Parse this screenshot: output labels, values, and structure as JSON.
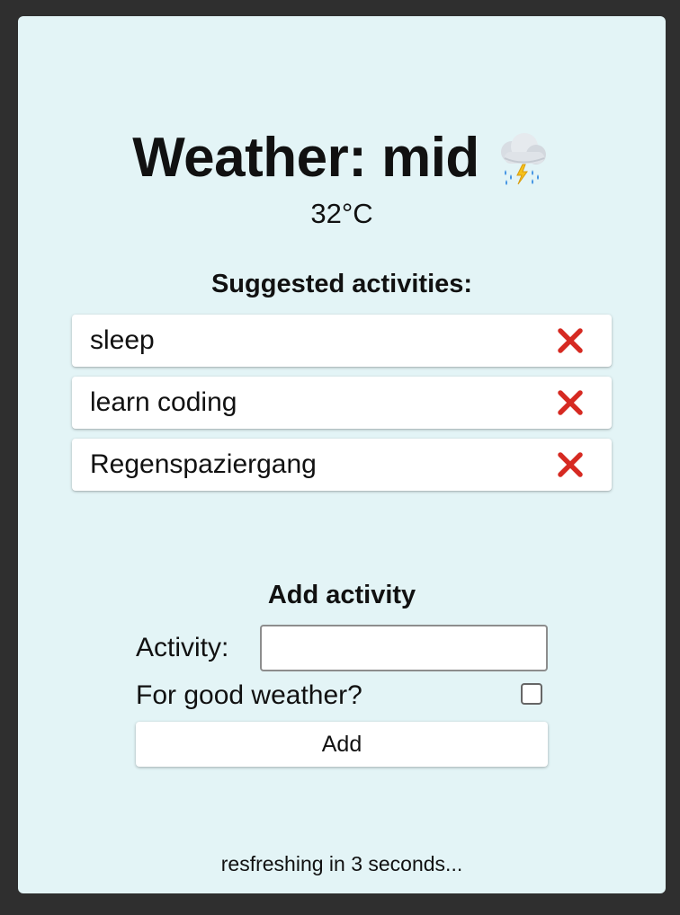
{
  "header": {
    "title": "Weather: mid",
    "weather_icon": "thunder-cloud-rain-icon",
    "temperature": "32°C"
  },
  "suggestions": {
    "title": "Suggested activities:",
    "items": [
      {
        "label": "sleep"
      },
      {
        "label": "learn coding"
      },
      {
        "label": "Regenspaziergang"
      }
    ],
    "delete_icon": "red-x-icon"
  },
  "form": {
    "title": "Add activity",
    "activity_label": "Activity:",
    "activity_value": "",
    "good_weather_label": "For good weather?",
    "good_weather_checked": false,
    "add_label": "Add"
  },
  "status": {
    "refresh_text": "resfreshing in 3 seconds..."
  },
  "colors": {
    "background": "#2f2f2f",
    "panel": "#e3f4f6",
    "delete": "#d62a22"
  }
}
